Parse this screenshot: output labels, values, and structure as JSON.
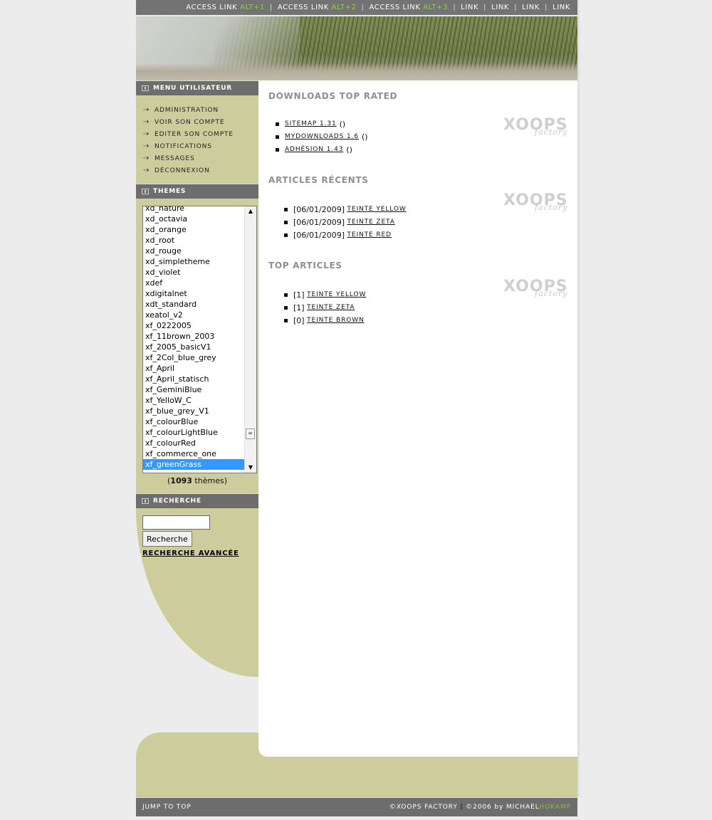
{
  "topnav": {
    "links": [
      {
        "label": "ACCESS LINK",
        "key": "ALT+1"
      },
      {
        "label": "ACCESS LINK",
        "key": "ALT+2"
      },
      {
        "label": "ACCESS LINK",
        "key": "ALT+3"
      }
    ],
    "simple_links": [
      "LINK",
      "LINK",
      "LINK",
      "LINK"
    ],
    "separator": "|"
  },
  "usermenu": {
    "title": "MENU UTILISATEUR",
    "items": [
      "ADMINISTRATION",
      "VOIR SON COMPTE",
      "EDITER SON COMPTE",
      "NOTIFICATIONS",
      "MESSAGES",
      "DÉCONNEXION"
    ]
  },
  "themes": {
    "title": "THEMES",
    "options": [
      "xd_nature",
      "xd_octavia",
      "xd_orange",
      "xd_root",
      "xd_rouge",
      "xd_simpletheme",
      "xd_violet",
      "xdef",
      "xdigitalnet",
      "xdt_standard",
      "xeatol_v2",
      "xf_0222005",
      "xf_11brown_2003",
      "xf_2005_basicV1",
      "xf_2Col_blue_grey",
      "xf_April",
      "xf_April_statisch",
      "xf_GeminiBlue",
      "xf_YelloW_C",
      "xf_blue_grey_V1",
      "xf_colourBlue",
      "xf_colourLightBlue",
      "xf_colourRed",
      "xf_commerce_one",
      "xf_greenGrass"
    ],
    "selected": "xf_greenGrass",
    "count": "1093",
    "count_label": "thèmes"
  },
  "search": {
    "title": "RECHERCHE",
    "input_value": "",
    "button_label": "Recherche",
    "advanced_link": "RECHERCHE AVANCÉE"
  },
  "watermark": {
    "big": "XOOPS",
    "small": "factory"
  },
  "sections": {
    "downloads": {
      "title": "DOWNLOADS TOP RATED",
      "items": [
        {
          "link": "SITEMAP 1.31",
          "suffix": "()"
        },
        {
          "link": "MYDOWNLOADS 1.6",
          "suffix": "()"
        },
        {
          "link": "ADHÉSION 1.43",
          "suffix": "()"
        }
      ]
    },
    "recent": {
      "title": "ARTICLES RÉCENTS",
      "items": [
        {
          "prefix": "[06/01/2009]",
          "link": "TEINTE YELLOW"
        },
        {
          "prefix": "[06/01/2009]",
          "link": "TEINTE ZETA"
        },
        {
          "prefix": "[06/01/2009]",
          "link": "TEINTE RED"
        }
      ]
    },
    "top": {
      "title": "TOP ARTICLES",
      "items": [
        {
          "prefix": "[1]",
          "link": "TEINTE YELLOW"
        },
        {
          "prefix": "[1]",
          "link": "TEINTE ZETA"
        },
        {
          "prefix": "[0]",
          "link": "TEINTE BROWN"
        }
      ]
    }
  },
  "footer": {
    "jump": "JUMP TO TOP",
    "copyright": "©XOOPS FACTORY",
    "sep": "|",
    "year_by": "©2006 by MICHAEL",
    "author_highlight": "HOKAMP"
  },
  "colors": {
    "accent_green": "#7ec23a",
    "sidebar": "#cdcc9d",
    "bar": "#6d6d6d",
    "selection": "#3399ff"
  }
}
